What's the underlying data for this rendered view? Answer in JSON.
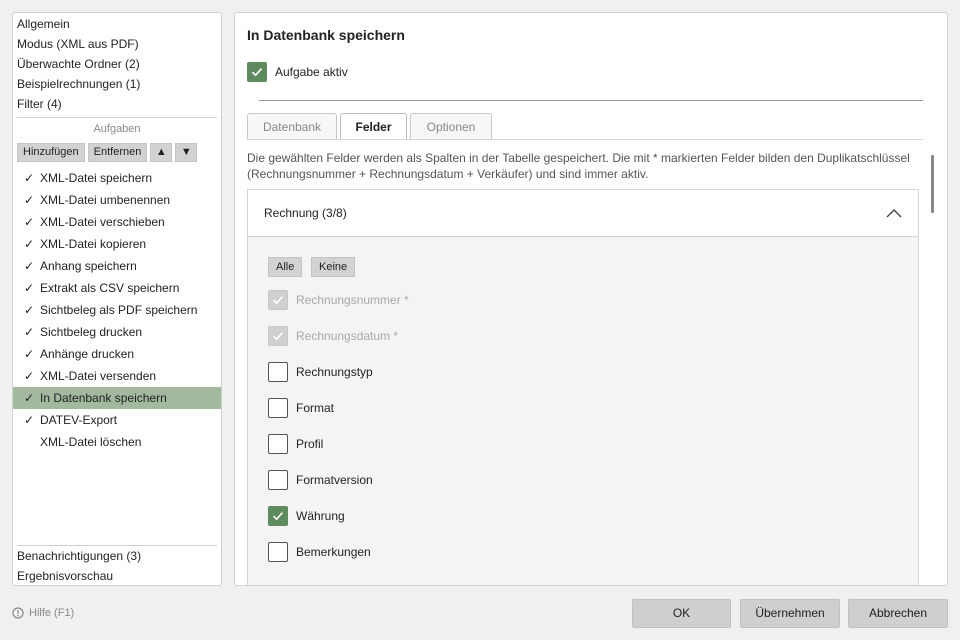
{
  "sidebar": {
    "nav_top": [
      "Allgemein",
      "Modus (XML aus PDF)",
      "Überwachte Ordner (2)",
      "Beispielrechnungen (1)",
      "Filter (4)"
    ],
    "tasks_header": "Aufgaben",
    "toolbar": {
      "add": "Hinzufügen",
      "remove": "Entfernen",
      "up": "▲",
      "down": "▼"
    },
    "tasks": [
      {
        "check": "✓",
        "label": "XML-Datei speichern"
      },
      {
        "check": "✓",
        "label": "XML-Datei umbenennen"
      },
      {
        "check": "✓",
        "label": "XML-Datei verschieben"
      },
      {
        "check": "✓",
        "label": "XML-Datei kopieren"
      },
      {
        "check": "✓",
        "label": "Anhang speichern"
      },
      {
        "check": "✓",
        "label": "Extrakt als CSV speichern"
      },
      {
        "check": "✓",
        "label": "Sichtbeleg als PDF speichern"
      },
      {
        "check": "✓",
        "label": "Sichtbeleg drucken"
      },
      {
        "check": "✓",
        "label": "Anhänge drucken"
      },
      {
        "check": "✓",
        "label": "XML-Datei versenden"
      },
      {
        "check": "✓",
        "label": "In Datenbank speichern"
      },
      {
        "check": "✓",
        "label": "DATEV-Export"
      },
      {
        "check": "",
        "label": "XML-Datei löschen"
      }
    ],
    "nav_bottom": [
      "Benachrichtigungen (3)",
      "Ergebnisvorschau"
    ]
  },
  "main": {
    "title": "In Datenbank speichern",
    "active_label": "Aufgabe aktiv",
    "tabs": [
      "Datenbank",
      "Felder",
      "Optionen"
    ],
    "description": "Die gewählten Felder werden als Spalten in der Tabelle gespeichert. Die mit * markierten Felder bilden den Duplikatschlüssel (Rechnungsnummer + Rechnungsdatum + Verkäufer) und sind immer aktiv.",
    "section": {
      "title": "Rechnung (3/8)",
      "all_label": "Alle",
      "none_label": "Keine",
      "fields": [
        {
          "label": "Rechnungsnummer *",
          "state": "disabled-checked"
        },
        {
          "label": "Rechnungsdatum *",
          "state": "disabled-checked"
        },
        {
          "label": "Rechnungstyp",
          "state": "unchecked"
        },
        {
          "label": "Format",
          "state": "unchecked"
        },
        {
          "label": "Profil",
          "state": "unchecked"
        },
        {
          "label": "Formatversion",
          "state": "unchecked"
        },
        {
          "label": "Währung",
          "state": "checked"
        },
        {
          "label": "Bemerkungen",
          "state": "unchecked"
        }
      ]
    }
  },
  "footer": {
    "help": "Hilfe (F1)",
    "ok": "OK",
    "apply": "Übernehmen",
    "cancel": "Abbrechen"
  },
  "colors": {
    "accent": "#5e8a60",
    "selection": "#a2b89f"
  }
}
